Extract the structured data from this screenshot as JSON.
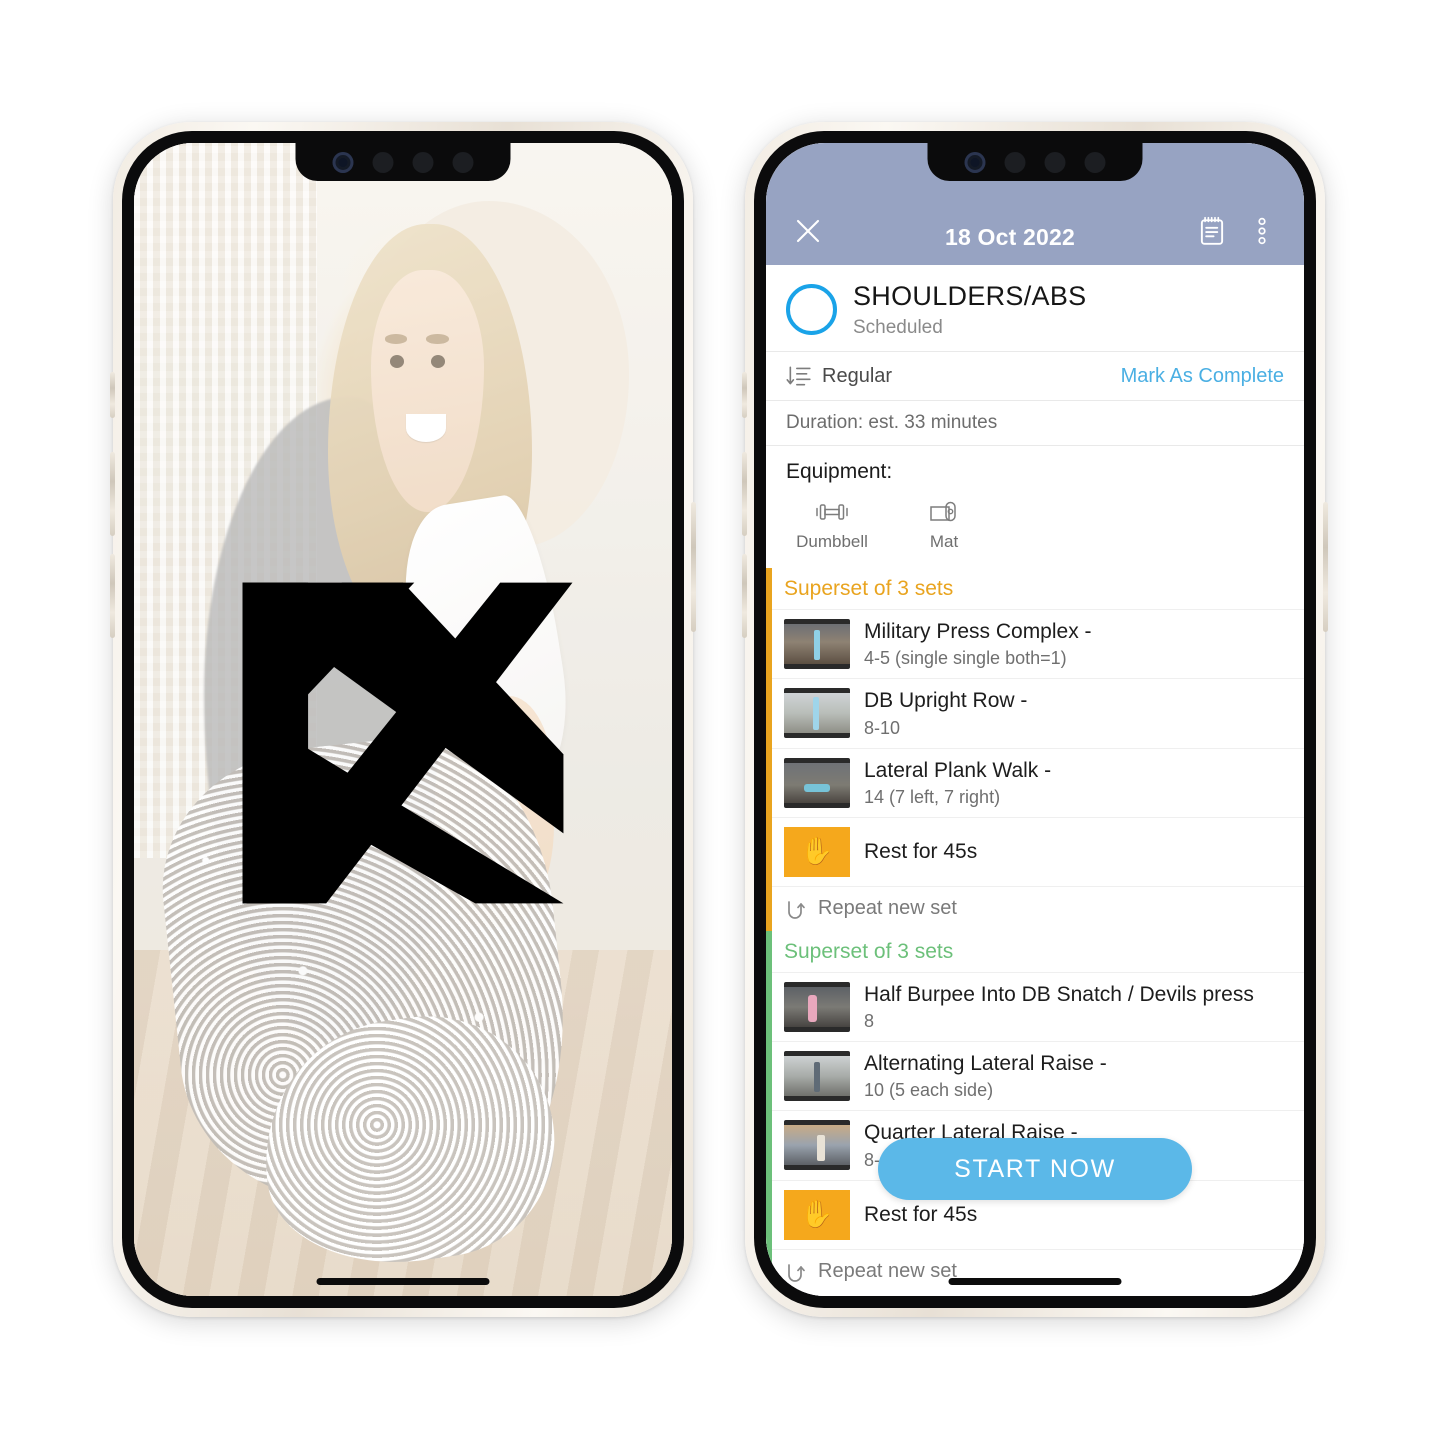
{
  "left_phone": {
    "screen_name": "app-splash-screen",
    "logo": {
      "name": "kx-logo",
      "alt_text": "K"
    }
  },
  "right_phone": {
    "appbar": {
      "close_label": "✕",
      "title": "18 Oct 2022",
      "notes_icon": "notepad-icon",
      "overflow_icon": "more-vertical-icon"
    },
    "workout": {
      "status_circle": "incomplete-circle",
      "name": "SHOULDERS/ABS",
      "status": "Scheduled",
      "sort_icon": "sort-descending-icon",
      "sort_label": "Regular",
      "mark_complete_label": "Mark As Complete",
      "duration": "Duration: est. 33 minutes"
    },
    "equipment": {
      "title": "Equipment:",
      "items": [
        {
          "icon": "dumbbell-icon",
          "label": "Dumbbell"
        },
        {
          "icon": "mat-icon",
          "label": "Mat"
        }
      ]
    },
    "groups": [
      {
        "title": "Superset of 3 sets",
        "color": "#e9a41f",
        "exercises": [
          {
            "name": "Military Press Complex -",
            "reps": "4-5 (single single both=1)"
          },
          {
            "name": "DB Upright Row -",
            "reps": "8-10"
          },
          {
            "name": "Lateral Plank Walk -",
            "reps": "14 (7 left, 7 right)"
          }
        ],
        "rest": {
          "icon": "hand-icon",
          "label": "Rest for 45s"
        },
        "repeat": {
          "icon": "repeat-icon",
          "label": "Repeat new set"
        }
      },
      {
        "title": "Superset of 3 sets",
        "color": "#6cc07a",
        "exercises": [
          {
            "name": "Half Burpee Into DB Snatch / Devils press",
            "reps": "8"
          },
          {
            "name": "Alternating Lateral Raise -",
            "reps": "10 (5 each side)"
          },
          {
            "name": "Quarter Lateral Raise -",
            "reps": "8-10"
          }
        ],
        "rest": {
          "icon": "hand-icon",
          "label": "Rest for 45s"
        },
        "repeat": {
          "icon": "repeat-icon",
          "label": "Repeat new set"
        }
      }
    ],
    "start_button_label": "START NOW"
  },
  "colors": {
    "appbar": "#97a3c2",
    "accent_blue": "#5bb8e8",
    "link_blue": "#4aafe3",
    "superset_amber": "#e9a41f",
    "superset_green": "#6cc07a",
    "rest_orange": "#f5a81c"
  }
}
